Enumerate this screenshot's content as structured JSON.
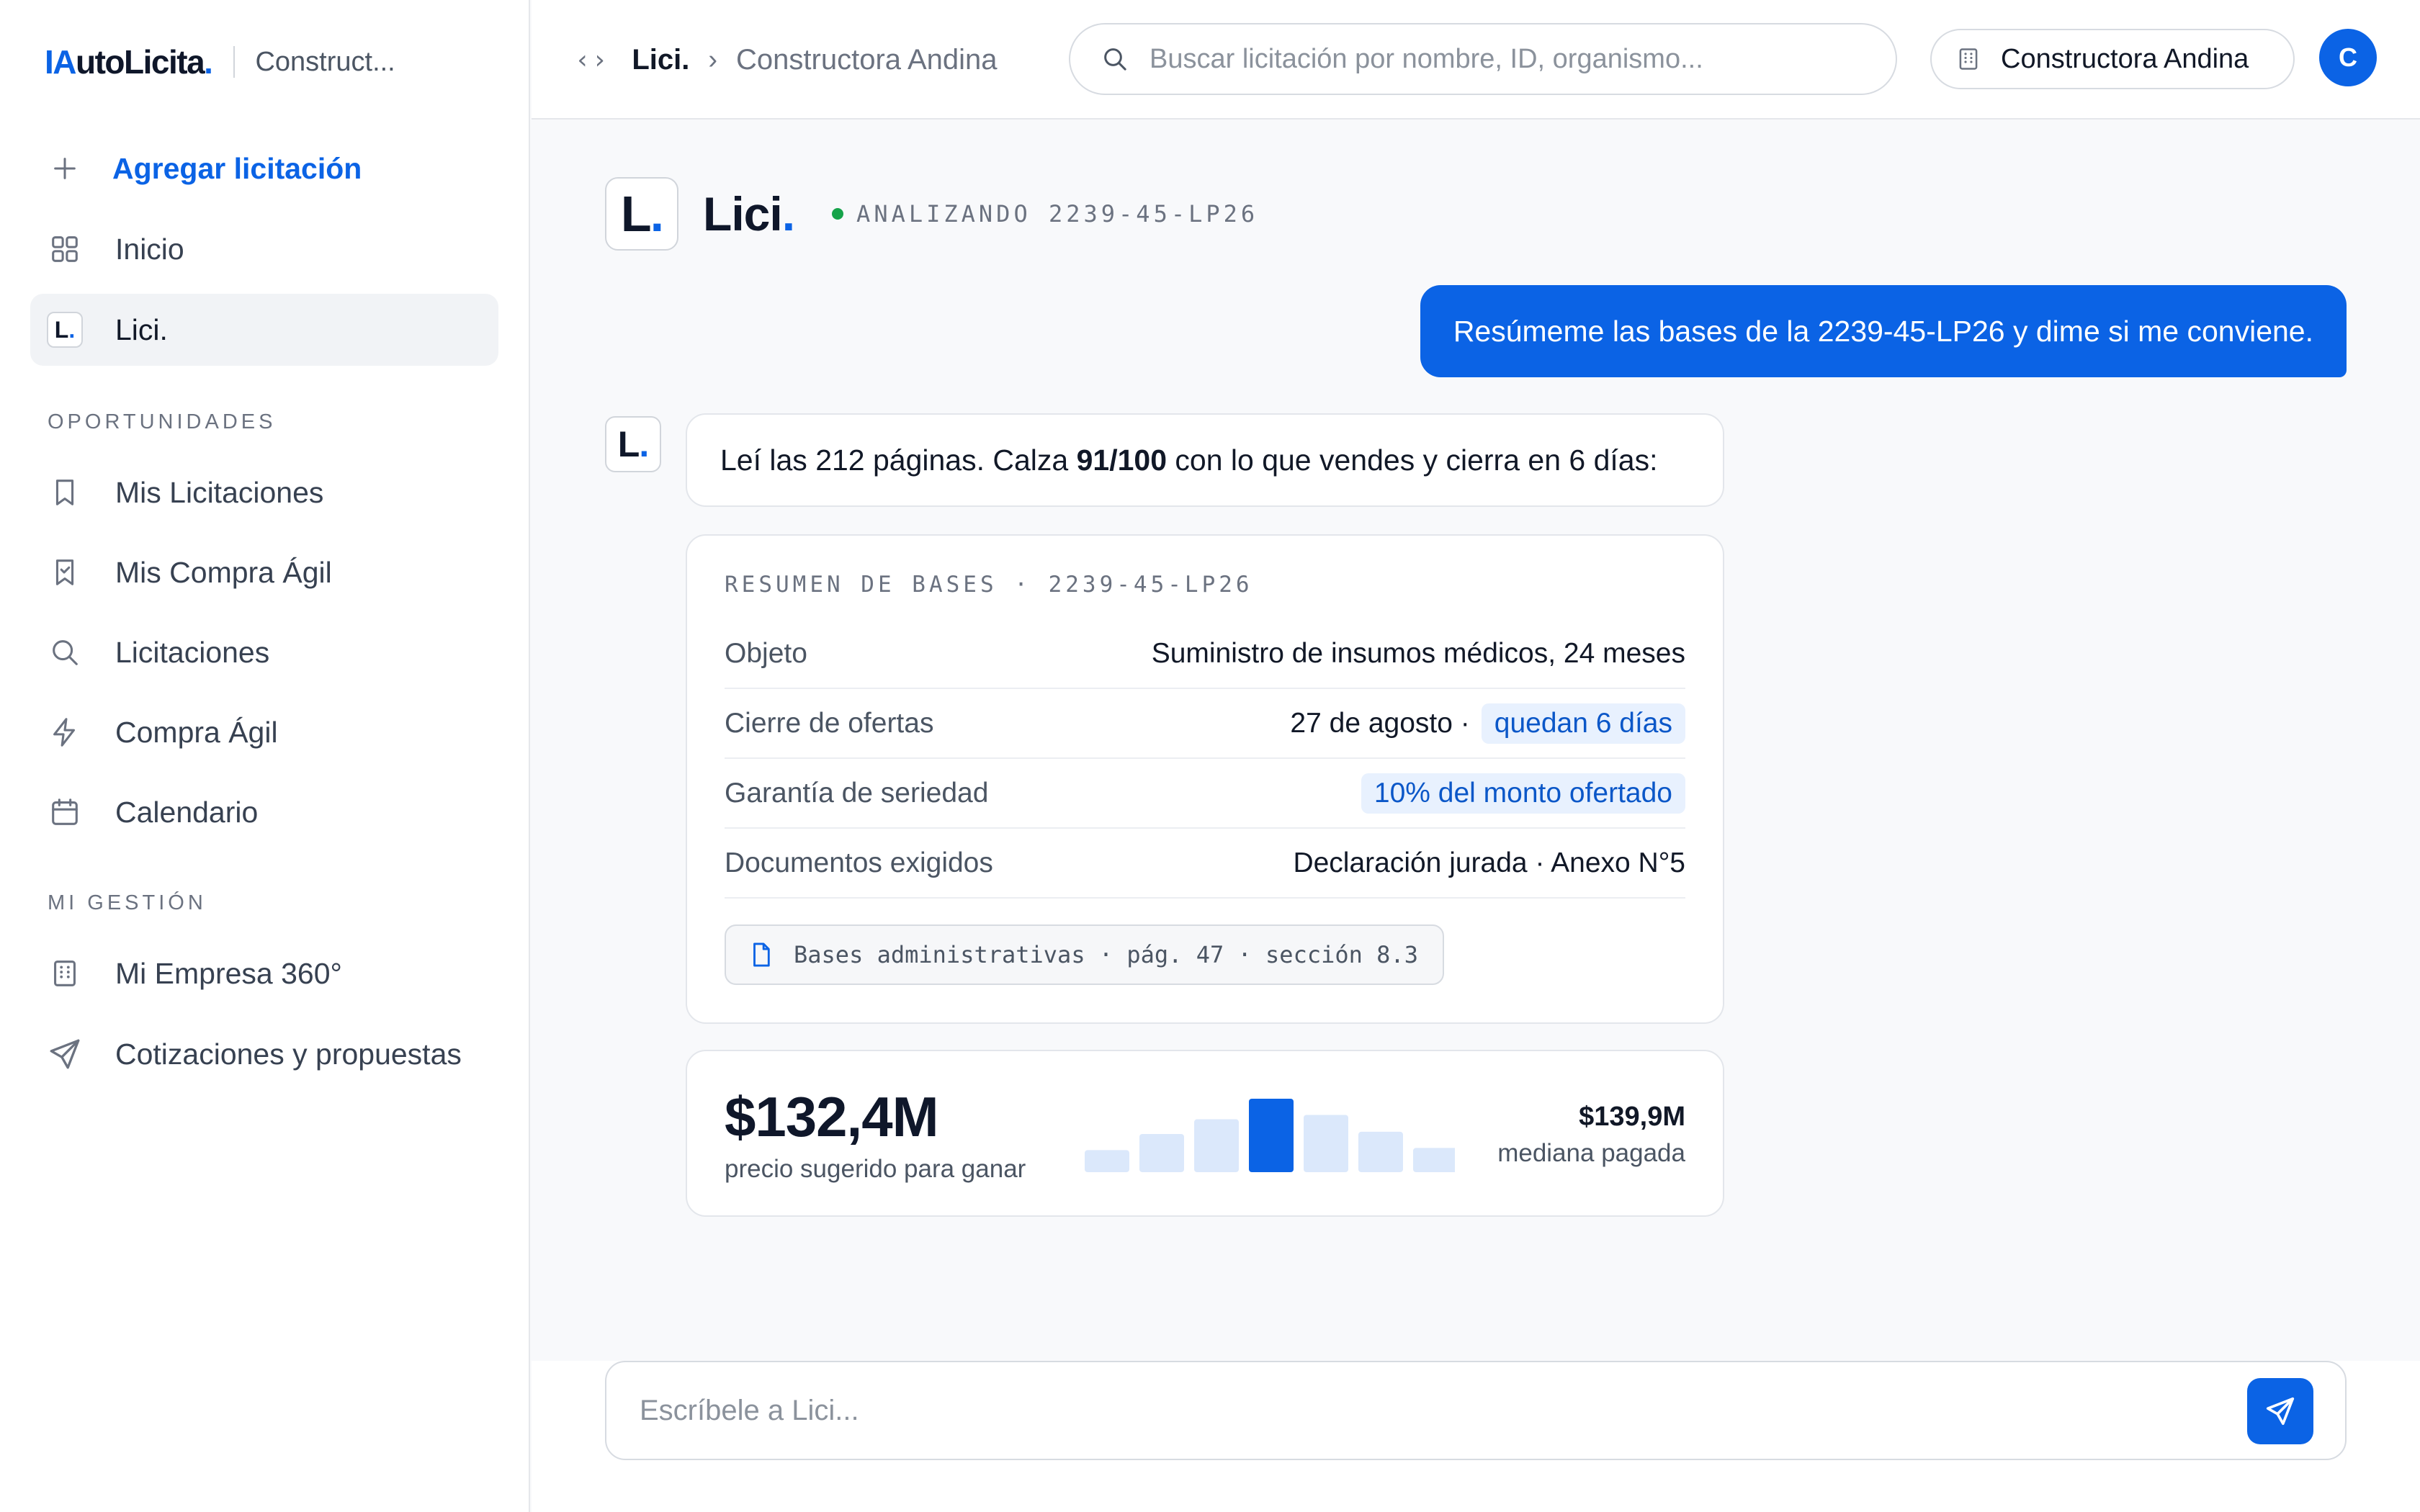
{
  "brand": {
    "prefix": "IA",
    "main": "utoLicita",
    "dot": ".",
    "org_short": "Construct..."
  },
  "sidebar": {
    "add_label": "Agregar licitación",
    "items_top": [
      {
        "label": "Inicio",
        "icon": "grid-icon"
      },
      {
        "label": "Lici.",
        "icon": "lici-badge-icon",
        "active": true
      }
    ],
    "section_opportunities": "OPORTUNIDADES",
    "items_opportunities": [
      {
        "label": "Mis Licitaciones",
        "icon": "bookmark-icon"
      },
      {
        "label": "Mis Compra Ágil",
        "icon": "bookmark-check-icon"
      },
      {
        "label": "Licitaciones",
        "icon": "search-icon"
      },
      {
        "label": "Compra Ágil",
        "icon": "bolt-icon"
      },
      {
        "label": "Calendario",
        "icon": "calendar-icon"
      }
    ],
    "section_management": "MI GESTIÓN",
    "items_management": [
      {
        "label": "Mi Empresa 360°",
        "icon": "building-icon"
      },
      {
        "label": "Cotizaciones y propuestas",
        "icon": "send-icon"
      }
    ]
  },
  "topbar": {
    "code_glyph": "‹›",
    "breadcrumb_root": "Lici.",
    "breadcrumb_sep": "›",
    "breadcrumb_current": "Constructora Andina",
    "search_placeholder": "Buscar licitación por nombre, ID, organismo...",
    "org_name": "Constructora Andina",
    "avatar_initial": "C"
  },
  "chat": {
    "assistant_name": "Lici",
    "assistant_dot": ".",
    "logo_letter": "L",
    "status": "ANALIZANDO 2239-45-LP26",
    "user_message": "Resúmeme las bases de la 2239-45-LP26 y dime si me conviene.",
    "bot_message_pre": "Leí las 212 páginas. Calza ",
    "bot_message_score": "91/100",
    "bot_message_post": " con lo que vendes y cierra en 6 días:",
    "summary": {
      "title": "RESUMEN DE BASES · 2239-45-LP26",
      "rows": [
        {
          "key": "Objeto",
          "value": "Suministro de insumos médicos, 24 meses"
        },
        {
          "key": "Cierre de ofertas",
          "value": "27 de agosto ·",
          "tag": "quedan 6 días"
        },
        {
          "key": "Garantía de seriedad",
          "tag": "10% del monto ofertado"
        },
        {
          "key": "Documentos exigidos",
          "value": "Declaración jurada · Anexo N°5"
        }
      ],
      "doc_ref": "Bases administrativas · pág. 47 · sección 8.3"
    },
    "price": {
      "suggested": "$132,4M",
      "suggested_label": "precio sugerido para ganar",
      "median": "$139,9M",
      "median_label": "mediana pagada",
      "distribution": [
        0.3,
        0.52,
        0.72,
        1.0,
        0.78,
        0.55,
        0.33
      ],
      "highlight_index": 3,
      "colors": {
        "bar": "#dbe8fb",
        "highlight": "#0b63e5"
      }
    },
    "composer_placeholder": "Escríbele a Lici..."
  },
  "colors": {
    "accent": "#0b63e5",
    "status_ok": "#16a34a",
    "tag_bg": "#e8f1fe"
  }
}
